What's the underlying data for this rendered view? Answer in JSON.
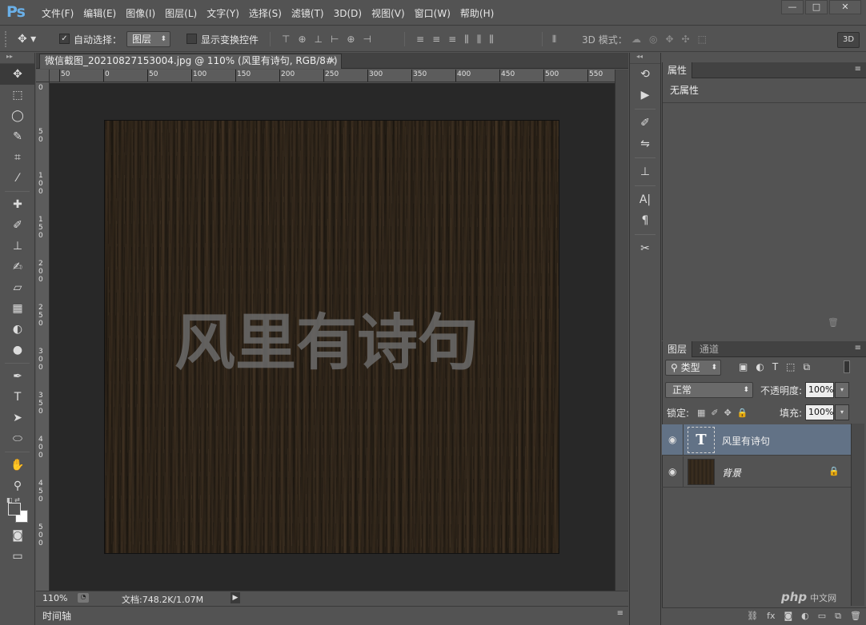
{
  "app": {
    "logo": "Ps"
  },
  "menu": [
    "文件(F)",
    "编辑(E)",
    "图像(I)",
    "图层(L)",
    "文字(Y)",
    "选择(S)",
    "滤镜(T)",
    "3D(D)",
    "视图(V)",
    "窗口(W)",
    "帮助(H)"
  ],
  "window_controls": {
    "minimize": "—",
    "maximize": "□",
    "close": "✕"
  },
  "options": {
    "auto_select_label": "自动选择：",
    "auto_select_checked": true,
    "auto_select_value": "图层",
    "show_transform_label": "显示变换控件",
    "show_transform_checked": false,
    "mode_3d_label": "3D 模式：",
    "btn_3d": "3D"
  },
  "document": {
    "tab_title": "微信截图_20210827153004.jpg @ 110% (风里有诗句, RGB/8#) *",
    "close": "×",
    "canvas_text": "风里有诗句"
  },
  "ruler_h": [
    "50",
    "0",
    "50",
    "100",
    "150",
    "200",
    "250",
    "300",
    "350",
    "400",
    "450",
    "500",
    "550"
  ],
  "ruler_v": [
    "0",
    "5\n0",
    "1\n0\n0",
    "1\n5\n0",
    "2\n0\n0",
    "2\n5\n0",
    "3\n0\n0",
    "3\n5\n0",
    "4\n0\n0",
    "4\n5\n0",
    "5\n0\n0"
  ],
  "status": {
    "zoom": "110%",
    "doc_info": "文档:748.2K/1.07M",
    "arrow": "▶"
  },
  "timeline": {
    "label": "时间轴"
  },
  "properties": {
    "tab": "属性",
    "text": "无属性"
  },
  "layers_panel": {
    "tab_layers": "图层",
    "tab_channels": "通道",
    "kind": "类型",
    "blend_mode": "正常",
    "opacity_label": "不透明度:",
    "opacity": "100%",
    "lock_label": "锁定:",
    "fill_label": "填充:",
    "fill": "100%",
    "layers": [
      {
        "name": "风里有诗句",
        "type": "text",
        "thumb": "T",
        "selected": true
      },
      {
        "name": "背景",
        "type": "background",
        "locked": true
      }
    ]
  },
  "watermark": {
    "brand": "php",
    "sub": "中文网"
  }
}
